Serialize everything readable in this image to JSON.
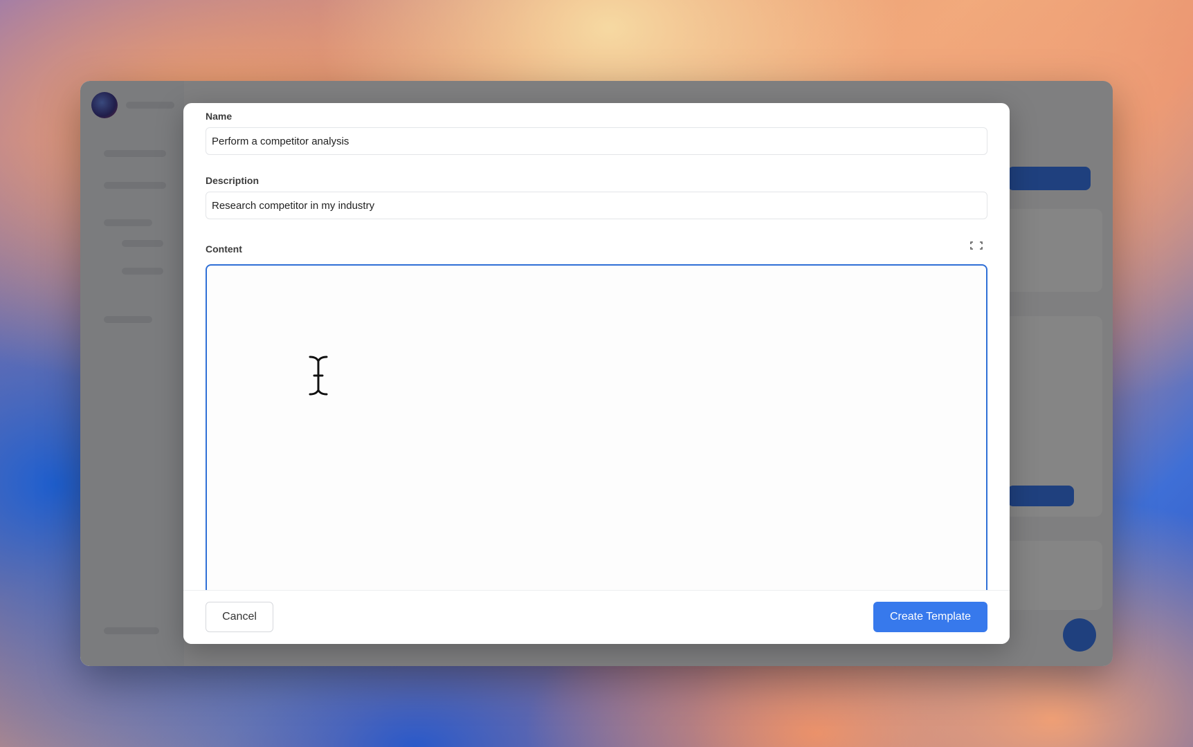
{
  "form": {
    "name_label": "Name",
    "name_value": "Perform a competitor analysis",
    "description_label": "Description",
    "description_value": "Research competitor in my industry",
    "content_label": "Content",
    "content_value": "",
    "expand_icon": "expand-icon"
  },
  "footer": {
    "cancel_label": "Cancel",
    "create_label": "Create Template"
  },
  "colors": {
    "accent": "#3779ec",
    "focus_border": "#2f6fd6"
  },
  "cursor": "text-cursor-icon"
}
